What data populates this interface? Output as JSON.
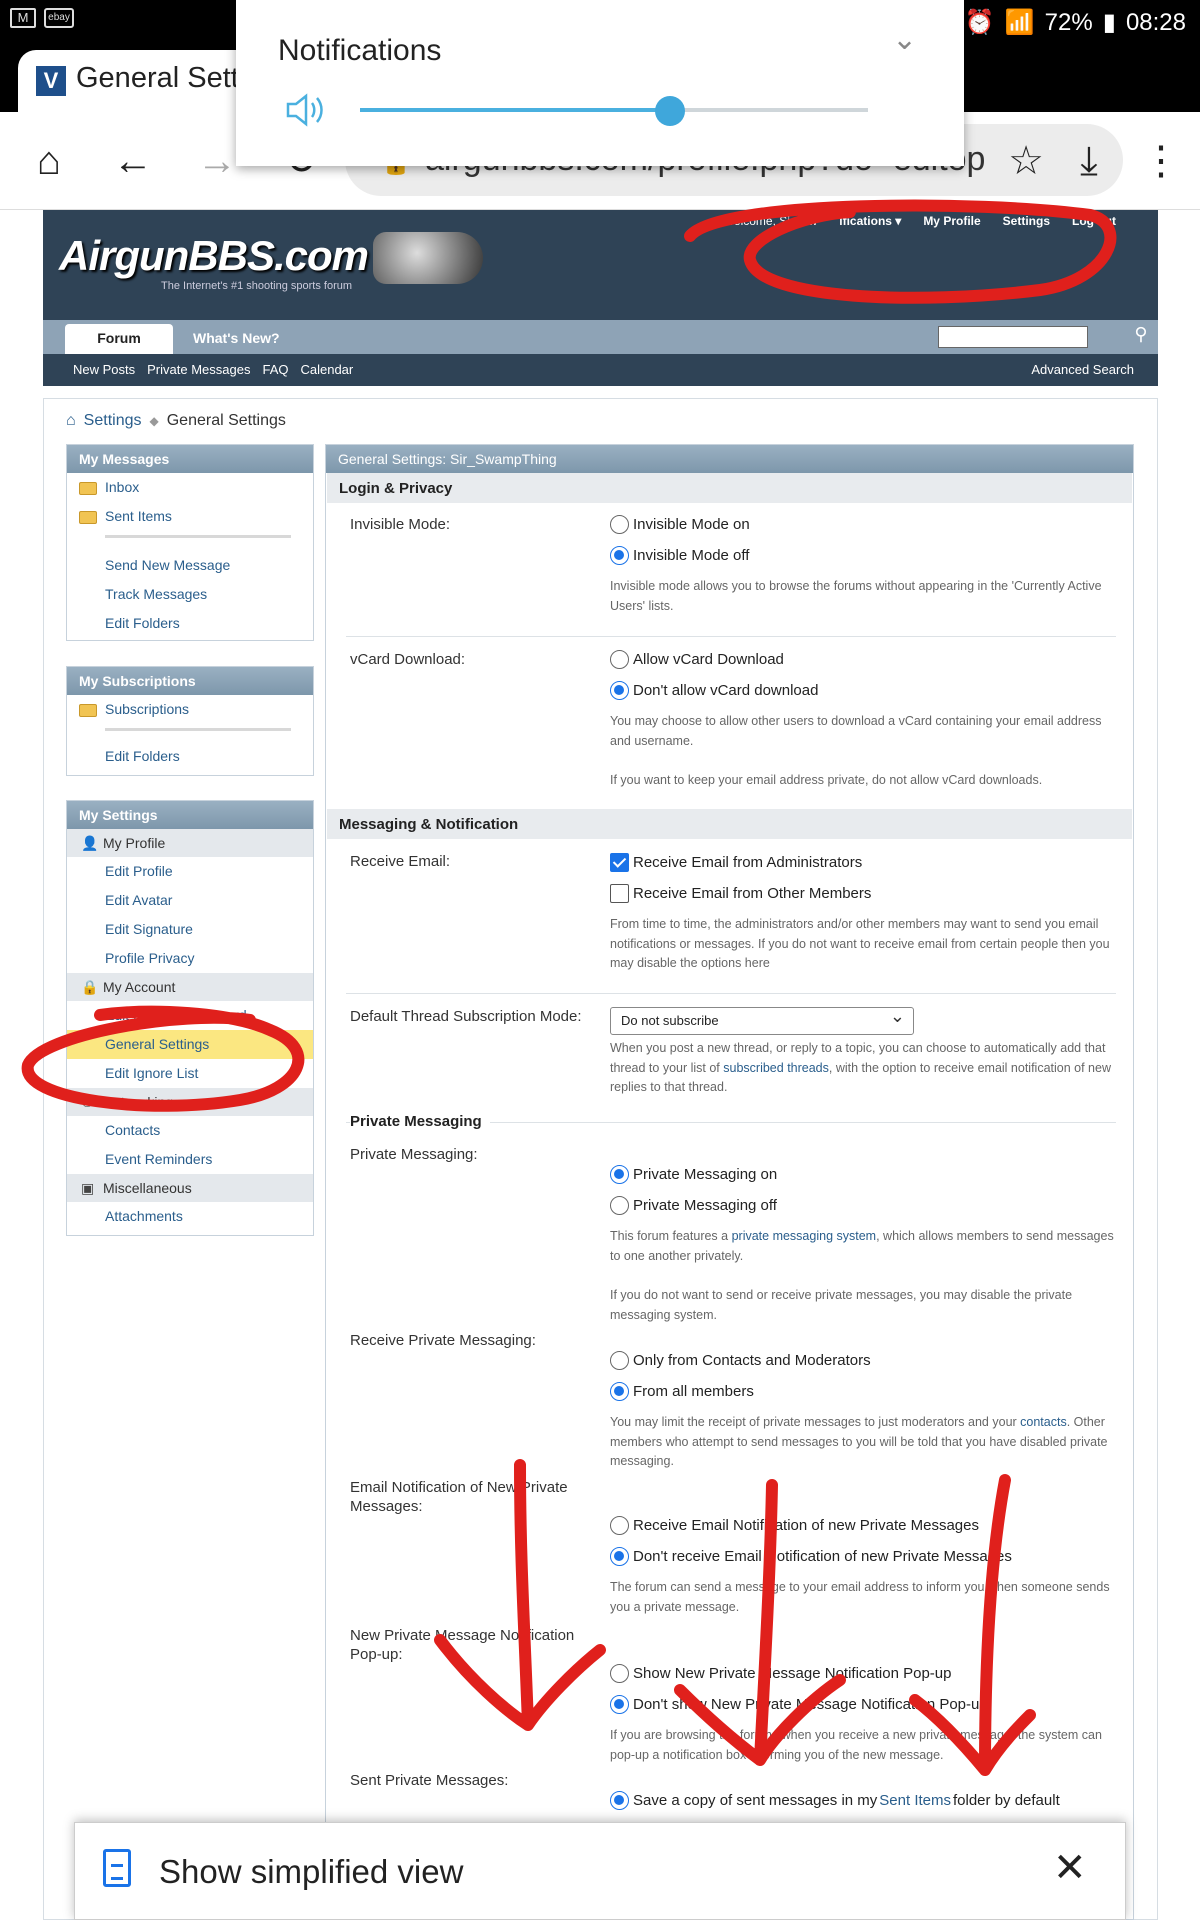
{
  "status_bar": {
    "battery": "72%",
    "time": "08:28"
  },
  "browser": {
    "tab_title": "General Setti",
    "url": "airgunbbs.com/profile.php?do=editop",
    "icons": [
      "home-icon",
      "back-icon",
      "forward-icon",
      "reload-icon",
      "lock-icon",
      "star-icon",
      "download-icon",
      "more-icon"
    ]
  },
  "notification_panel": {
    "title": "Notifications",
    "volume_level": 0.61
  },
  "site": {
    "logo": "AirgunBBS.com",
    "tagline": "The Internet's #1 shooting sports forum",
    "top_links": [
      "Welcome, Sir_Sw",
      "ifications ▾",
      "My Profile",
      "Settings",
      "Log out"
    ],
    "nav_tabs": [
      "Forum",
      "What's New?"
    ],
    "sub_nav": [
      "New Posts",
      "Private Messages",
      "FAQ",
      "Calendar"
    ],
    "advanced_search": "Advanced Search"
  },
  "breadcrumb": {
    "root": "Settings",
    "current": "General Settings"
  },
  "sidebar": {
    "messages": {
      "title": "My Messages",
      "inbox": "Inbox",
      "sent": "Sent Items",
      "send_new": "Send New Message",
      "track": "Track Messages",
      "edit_folders": "Edit Folders"
    },
    "subscriptions": {
      "title": "My Subscriptions",
      "subs": "Subscriptions",
      "edit_folders": "Edit Folders"
    },
    "settings": {
      "title": "My Settings",
      "profile": "My Profile",
      "edit_profile": "Edit Profile",
      "edit_avatar": "Edit Avatar",
      "edit_signature": "Edit Signature",
      "profile_privacy": "Profile Privacy",
      "account": "My Account",
      "email_password": "Edit Email & Password",
      "general": "General Settings",
      "ignore": "Edit Ignore List",
      "networking": "Networking",
      "contacts": "Contacts",
      "reminders": "Event Reminders",
      "misc": "Miscellaneous",
      "attachments": "Attachments"
    }
  },
  "main": {
    "header": "General Settings: Sir_SwampThing",
    "login_privacy": {
      "title": "Login & Privacy",
      "invisible_label": "Invisible Mode:",
      "invisible_on": "Invisible Mode on",
      "invisible_off": "Invisible Mode off",
      "invisible_desc": "Invisible mode allows you to browse the forums without appearing in the 'Currently Active Users' lists.",
      "vcard_label": "vCard Download:",
      "vcard_allow": "Allow vCard Download",
      "vcard_deny": "Don't allow vCard download",
      "vcard_desc1": "You may choose to allow other users to download a vCard containing your email address and username.",
      "vcard_desc2": "If you want to keep your email address private, do not allow vCard downloads."
    },
    "messaging": {
      "title": "Messaging & Notification",
      "receive_email_label": "Receive Email:",
      "from_admins": "Receive Email from Administrators",
      "from_members": "Receive Email from Other Members",
      "email_desc": "From time to time, the administrators and/or other members may want to send you email notifications or messages. If you do not want to receive email from certain people then you may disable the options here",
      "sub_mode_label": "Default Thread Subscription Mode:",
      "sub_mode_value": "Do not subscribe",
      "sub_desc_a": "When you post a new thread, or reply to a topic, you can choose to automatically add that thread to your list of ",
      "sub_desc_link": "subscribed threads",
      "sub_desc_b": ", with the option to receive email notification of new replies to that thread.",
      "pm_section": "Private Messaging",
      "pm_label": "Private Messaging:",
      "pm_on": "Private Messaging on",
      "pm_off": "Private Messaging off",
      "pm_desc_a": "This forum features a ",
      "pm_desc_link": "private messaging system",
      "pm_desc_b": ", which allows members to send messages to one another privately.",
      "pm_desc2": "If you do not want to send or receive private messages, you may disable the private messaging system.",
      "recv_pm_label": "Receive Private Messaging:",
      "recv_contacts": "Only from Contacts and Moderators",
      "recv_all": "From all members",
      "recv_desc_a": "You may limit the receipt of private messages to just moderators and your ",
      "recv_desc_link": "contacts",
      "recv_desc_b": ". Other members who attempt to send messages to you will be told that you have disabled private messaging.",
      "email_pm_label": "Email Notification of New Private Messages:",
      "email_pm_on": "Receive Email Notification of new Private Messages",
      "email_pm_off": "Don't receive Email Notification of new Private Messages",
      "email_pm_desc": "The forum can send a message to your email address to inform you when someone sends you a private message.",
      "popup_label": "New Private Message Notification Pop-up:",
      "popup_on": "Show New Private Message Notification Pop-up",
      "popup_off": "Don't show New Private Message Notification Pop-up",
      "popup_desc": "If you are browsing the forums when you receive a new private message, the system can pop-up a notification box informing you of the new message.",
      "sent_label": "Sent Private Messages:",
      "sent_a": "Save a copy of sent messages in my ",
      "sent_link": "Sent Items",
      "sent_b": " folder by default"
    }
  },
  "simplified_view": {
    "label": "Show simplified view"
  },
  "colors": {
    "header_bg": "#2f4356",
    "panel_header": "#8aa1b5",
    "link": "#2a5e8c",
    "active_item": "#fbe781",
    "annotation": "#e0201c"
  }
}
